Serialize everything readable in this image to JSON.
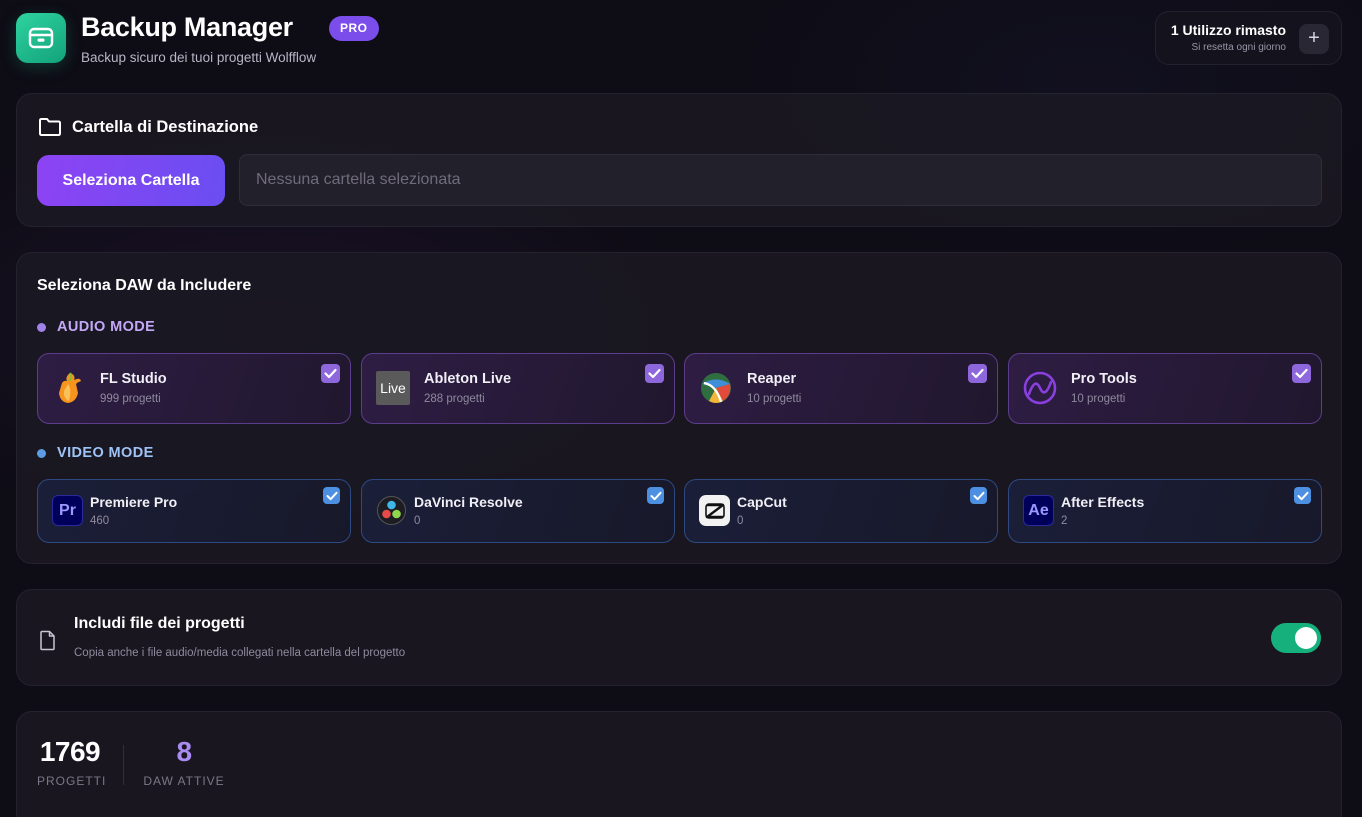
{
  "header": {
    "title": "Backup Manager",
    "badge": "PRO",
    "subtitle": "Backup sicuro dei tuoi progetti Wolfflow",
    "usage_title": "1 Utilizzo rimasto",
    "usage_sub": "Si resetta ogni giorno",
    "usage_add": "+"
  },
  "destination": {
    "title": "Cartella di Destinazione",
    "button_label": "Seleziona Cartella",
    "path_placeholder": "Nessuna cartella selezionata"
  },
  "daw": {
    "title": "Seleziona DAW da Includere",
    "audio_label": "AUDIO MODE",
    "video_label": "VIDEO MODE",
    "audio": [
      {
        "name": "FL Studio",
        "count": "999 progetti",
        "checked": true,
        "icon": "fl-studio-icon"
      },
      {
        "name": "Ableton Live",
        "count": "288 progetti",
        "checked": true,
        "icon": "ableton-live-icon",
        "logo_text": "Live"
      },
      {
        "name": "Reaper",
        "count": "10 progetti",
        "checked": true,
        "icon": "reaper-icon"
      },
      {
        "name": "Pro Tools",
        "count": "10 progetti",
        "checked": true,
        "icon": "pro-tools-icon"
      }
    ],
    "video": [
      {
        "name": "Premiere Pro",
        "count": "460",
        "checked": true,
        "icon": "premiere-pro-icon",
        "logo_text": "Pr"
      },
      {
        "name": "DaVinci Resolve",
        "count": "0",
        "checked": true,
        "icon": "davinci-resolve-icon"
      },
      {
        "name": "CapCut",
        "count": "0",
        "checked": true,
        "icon": "capcut-icon"
      },
      {
        "name": "After Effects",
        "count": "2",
        "checked": true,
        "icon": "after-effects-icon",
        "logo_text": "Ae"
      }
    ]
  },
  "include_files": {
    "title": "Includi file dei progetti",
    "subtitle": "Copia anche i file audio/media collegati nella cartella del progetto",
    "enabled": true
  },
  "stats": {
    "projects_value": "1769",
    "projects_label": "PROGETTI",
    "daw_value": "8",
    "daw_label": "DAW ATTIVE"
  },
  "colors": {
    "accent_purple": "#7b4dea",
    "toggle_on": "#15b07b",
    "app_icon": "#1fbf8e",
    "audio_check": "#8e67dd",
    "video_check": "#4d8fe0"
  }
}
